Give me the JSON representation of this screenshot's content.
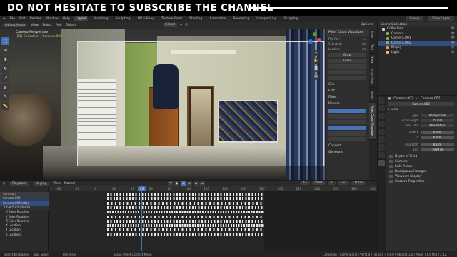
{
  "banner": {
    "text": "DO NOT HESITATE TO SUBSCRIBE THE CHANNEL"
  },
  "topbar": {
    "menu": [
      "File",
      "Edit",
      "Render",
      "Window",
      "Help"
    ],
    "workspaces": [
      "Layout",
      "Modeling",
      "Sculpting",
      "UV Editing",
      "Texture Paint",
      "Shading",
      "Animation",
      "Rendering",
      "Compositing",
      "Scripting"
    ],
    "active_workspace": "Layout",
    "scene": "Scene",
    "view_layer": "View Layer"
  },
  "viewport_header": {
    "mode": "Object Mode",
    "menus": [
      "View",
      "Select",
      "Add",
      "Object"
    ],
    "pivot": "Global",
    "options": "Options"
  },
  "viewport": {
    "overlay_title": "Camera Perspective",
    "overlay_subtitle": "(21) Collection | Camera.002"
  },
  "tools": [
    "cursor",
    "move",
    "rotate",
    "scale",
    "transform",
    "annotate",
    "measure"
  ],
  "npanel": {
    "title": "Point Cloud Visualizer",
    "ply_label": "PLY File:",
    "rows": [
      {
        "label": "Selected:",
        "value": "n/a"
      },
      {
        "label": "Loaded:",
        "value": "n/a"
      }
    ],
    "buttons": [
      "Draw",
      "Erase"
    ],
    "sections": [
      "Clip",
      "Edit",
      "Filter",
      "Render",
      "Convert",
      "Generate"
    ],
    "tabs": [
      "Item",
      "Tool",
      "View",
      "Light Cuts",
      "Nodes",
      "Point Cloud Visualizer"
    ]
  },
  "outliner": {
    "header": "Scene Collection",
    "items": [
      {
        "label": "Collection",
        "color": "#cfcfcf",
        "selected": false
      },
      {
        "label": "Camera",
        "color": "#7fb356",
        "selected": false
      },
      {
        "label": "Camera.001",
        "color": "#7fb356",
        "selected": false
      },
      {
        "label": "Camera.002",
        "color": "#7fb356",
        "selected": true
      },
      {
        "label": "Empty",
        "color": "#e0a24a",
        "selected": false
      },
      {
        "label": "Light",
        "color": "#e0c060",
        "selected": false
      }
    ]
  },
  "properties": {
    "breadcrumb": [
      "Camera.002",
      "Camera.002"
    ],
    "data_name": "Camera.002",
    "lens_section": "Lens",
    "fields": [
      {
        "label": "Type",
        "value": "Perspective"
      },
      {
        "label": "Focal Length",
        "value": "35 mm"
      },
      {
        "label": "Lens Unit",
        "value": "Millimeters"
      },
      {
        "label": "Shift X",
        "value": "0.000"
      },
      {
        "label": "Y",
        "value": "0.000"
      },
      {
        "label": "Clip Start",
        "value": "0.1 m"
      },
      {
        "label": "End",
        "value": "1000 m"
      }
    ],
    "sections": [
      "Depth of Field",
      "Camera",
      "Safe Areas",
      "Background Images",
      "Viewport Display",
      "Custom Properties"
    ]
  },
  "playback": {
    "menus": [
      "Playback",
      "Keying",
      "View",
      "Marker"
    ],
    "current_frame": "43",
    "start_label": "Start",
    "start": "1",
    "end_label": "End",
    "end": "1000"
  },
  "timeline": {
    "current_frame_label": "43",
    "ticks": [
      "-40",
      "-20",
      "0",
      "20",
      "40",
      "60",
      "80",
      "100",
      "120",
      "140",
      "160",
      "180",
      "200",
      "220",
      "240",
      "260",
      "280",
      "300"
    ],
    "channels": [
      {
        "label": "Summary",
        "kind": "sum"
      },
      {
        "label": "Camera.002",
        "kind": "obj"
      },
      {
        "label": "Camera.002Action",
        "kind": "act"
      },
      {
        "label": "Object Transforms",
        "kind": "grp"
      },
      {
        "label": "X Euler Rotation",
        "kind": "ch"
      },
      {
        "label": "Y Euler Rotation",
        "kind": "ch"
      },
      {
        "label": "Z Euler Rotation",
        "kind": "ch"
      },
      {
        "label": "X Location",
        "kind": "ch"
      },
      {
        "label": "Y Location",
        "kind": "ch"
      },
      {
        "label": "Z Location",
        "kind": "ch"
      }
    ]
  },
  "statusbar": {
    "left": "Select Keyframes",
    "mid1": "Box Select",
    "mid2": "Pan View",
    "mid3": "Dope Sheet Context Menu",
    "right": "Collection | Camera.002 | Verts:0 | Faces:0 | Tris:0 | Objects:1/4 | Mem: 54.9 MiB | 2.82.7"
  }
}
